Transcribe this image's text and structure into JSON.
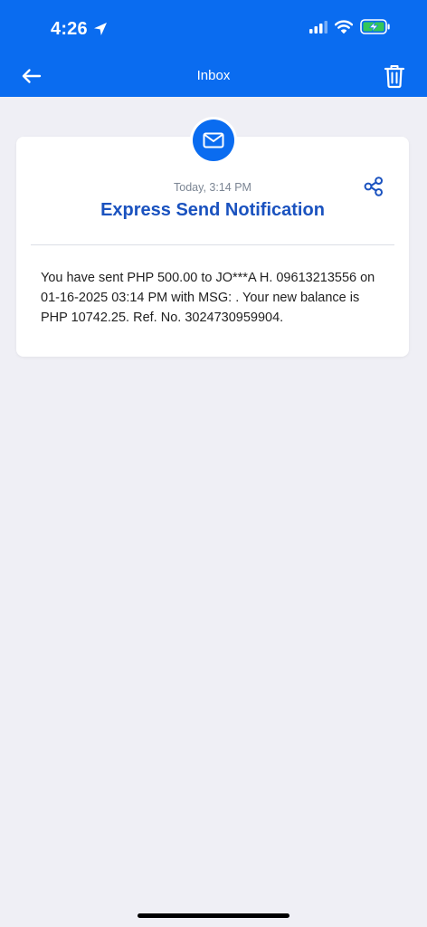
{
  "status_bar": {
    "time": "4:26",
    "location_icon": "location-arrow-icon",
    "signal_icon": "cellular-signal-icon",
    "wifi_icon": "wifi-icon",
    "battery_icon": "battery-charging-icon"
  },
  "header": {
    "title": "Inbox",
    "back_icon": "arrow-left-icon",
    "delete_icon": "trash-icon",
    "background_color": "#0a6cf0"
  },
  "message": {
    "icon": "mail-icon",
    "timestamp": "Today, 3:14 PM",
    "title": "Express Send Notification",
    "share_icon": "share-icon",
    "body": "You have sent PHP 500.00 to JO***A H. 09613213556 on 01-16-2025 03:14 PM with MSG: . Your new balance is PHP 10742.25. Ref. No. 3024730959904.",
    "title_color": "#1a52bf"
  },
  "colors": {
    "accent": "#0a6cf0",
    "background": "#efeff5",
    "battery_charge": "#34c759"
  }
}
